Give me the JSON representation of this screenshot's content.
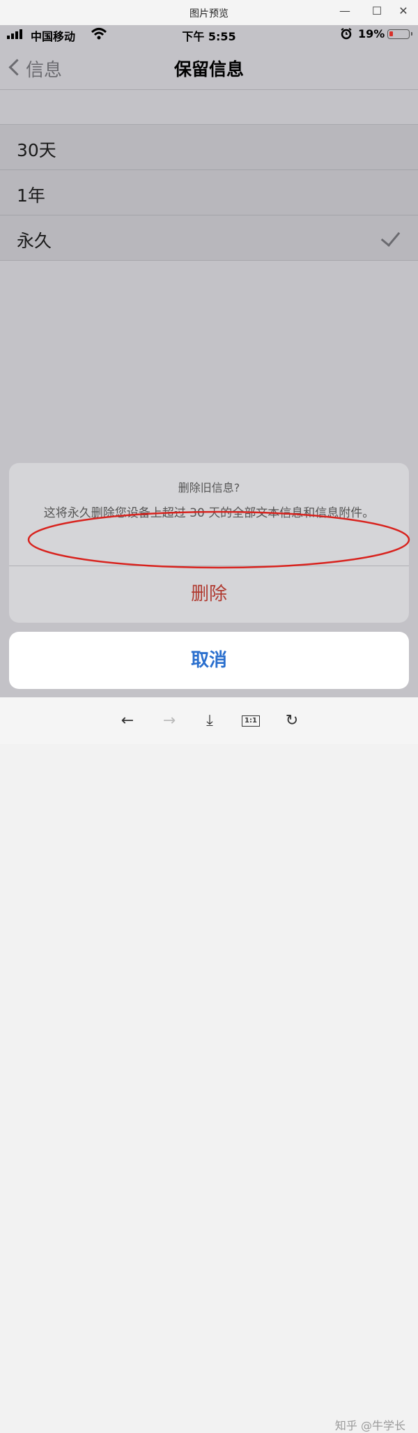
{
  "window": {
    "title": "图片预览",
    "min": "—",
    "max": "☐",
    "close": "✕"
  },
  "status": {
    "carrier": "中国移动",
    "time": "下午 5:55",
    "battery_pct": "19%",
    "battery_level": 0.19
  },
  "nav": {
    "back_label": "信息",
    "title": "保留信息"
  },
  "options": [
    {
      "label": "30天",
      "selected": false
    },
    {
      "label": "1年",
      "selected": false
    },
    {
      "label": "永久",
      "selected": true
    }
  ],
  "sheet": {
    "title": "删除旧信息?",
    "message": "这将永久删除您设备上超过 30 天的全部文本信息和信息附件。",
    "delete_label": "删除",
    "cancel_label": "取消",
    "highlight_color": "#d8231e"
  },
  "toolbar": {
    "back": "←",
    "forward": "→",
    "download": "⤓",
    "actual_size": "1:1",
    "rotate": "↻"
  },
  "watermark": "知乎 @牛学长"
}
